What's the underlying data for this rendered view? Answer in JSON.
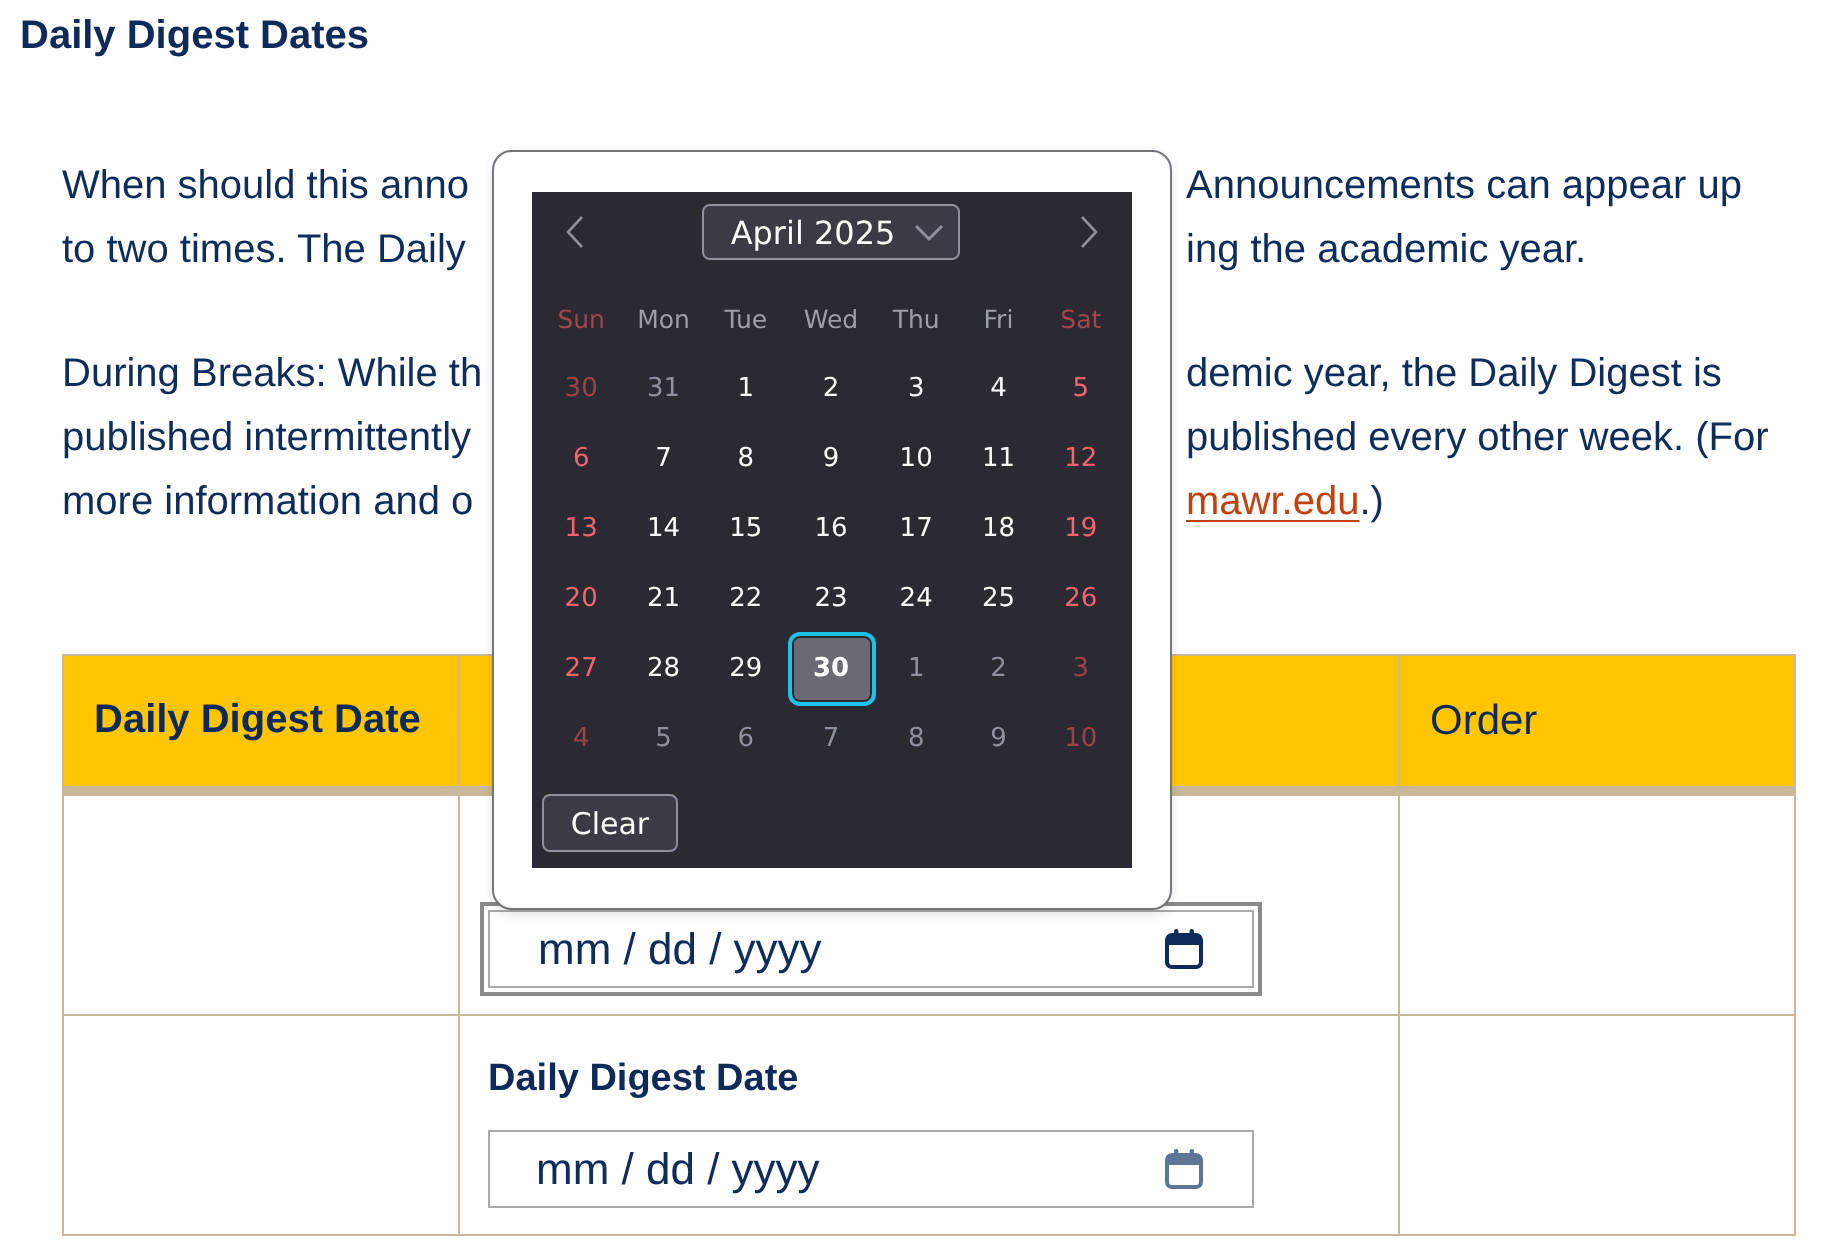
{
  "page": {
    "title": "Daily Digest Dates"
  },
  "intro": {
    "paragraphs": [
      {
        "lines": [
          {
            "before_popup": "When should this anno",
            "after_popup": [
              {
                "kind": "text",
                "text": "Announcements can appear up"
              }
            ]
          },
          {
            "before_popup": "to two times. The Daily",
            "after_popup": [
              {
                "kind": "text",
                "text": "ing the academic year."
              }
            ]
          }
        ]
      },
      {
        "lines": [
          {
            "before_popup": "During Breaks: While th",
            "after_popup": [
              {
                "kind": "text",
                "text": "demic year, the Daily Digest is"
              }
            ]
          },
          {
            "before_popup": "published intermittently",
            "after_popup": [
              {
                "kind": "text",
                "text": "published every other week. (For"
              }
            ]
          },
          {
            "before_popup": "more information and o",
            "after_popup": [
              {
                "kind": "link",
                "text": "mawr.edu"
              },
              {
                "kind": "text",
                "text": ".)"
              }
            ]
          }
        ]
      }
    ]
  },
  "table": {
    "columns": [
      {
        "label": "Daily Digest Date"
      },
      {},
      {
        "label": "Order"
      }
    ],
    "rows": [
      {
        "date_input": {
          "placeholder": "mm / dd / yyyy",
          "focused": true
        }
      },
      {
        "label": "Daily Digest Date",
        "date_input": {
          "placeholder": "mm / dd / yyyy",
          "focused": false
        }
      }
    ]
  },
  "date_picker": {
    "month_label": "April 2025",
    "weekdays": [
      {
        "label": "Sun",
        "weekend": true
      },
      {
        "label": "Mon",
        "weekend": false
      },
      {
        "label": "Tue",
        "weekend": false
      },
      {
        "label": "Wed",
        "weekend": false
      },
      {
        "label": "Thu",
        "weekend": false
      },
      {
        "label": "Fri",
        "weekend": false
      },
      {
        "label": "Sat",
        "weekend": true
      }
    ],
    "weeks": [
      [
        {
          "label": "30",
          "outside": true,
          "selected": false
        },
        {
          "label": "31",
          "outside": true,
          "selected": false
        },
        {
          "label": "1",
          "outside": false,
          "selected": false
        },
        {
          "label": "2",
          "outside": false,
          "selected": false
        },
        {
          "label": "3",
          "outside": false,
          "selected": false
        },
        {
          "label": "4",
          "outside": false,
          "selected": false
        },
        {
          "label": "5",
          "outside": false,
          "selected": false
        }
      ],
      [
        {
          "label": "6",
          "outside": false,
          "selected": false
        },
        {
          "label": "7",
          "outside": false,
          "selected": false
        },
        {
          "label": "8",
          "outside": false,
          "selected": false
        },
        {
          "label": "9",
          "outside": false,
          "selected": false
        },
        {
          "label": "10",
          "outside": false,
          "selected": false
        },
        {
          "label": "11",
          "outside": false,
          "selected": false
        },
        {
          "label": "12",
          "outside": false,
          "selected": false
        }
      ],
      [
        {
          "label": "13",
          "outside": false,
          "selected": false
        },
        {
          "label": "14",
          "outside": false,
          "selected": false
        },
        {
          "label": "15",
          "outside": false,
          "selected": false
        },
        {
          "label": "16",
          "outside": false,
          "selected": false
        },
        {
          "label": "17",
          "outside": false,
          "selected": false
        },
        {
          "label": "18",
          "outside": false,
          "selected": false
        },
        {
          "label": "19",
          "outside": false,
          "selected": false
        }
      ],
      [
        {
          "label": "20",
          "outside": false,
          "selected": false
        },
        {
          "label": "21",
          "outside": false,
          "selected": false
        },
        {
          "label": "22",
          "outside": false,
          "selected": false
        },
        {
          "label": "23",
          "outside": false,
          "selected": false
        },
        {
          "label": "24",
          "outside": false,
          "selected": false
        },
        {
          "label": "25",
          "outside": false,
          "selected": false
        },
        {
          "label": "26",
          "outside": false,
          "selected": false
        }
      ],
      [
        {
          "label": "27",
          "outside": false,
          "selected": false
        },
        {
          "label": "28",
          "outside": false,
          "selected": false
        },
        {
          "label": "29",
          "outside": false,
          "selected": false
        },
        {
          "label": "30",
          "outside": false,
          "selected": true
        },
        {
          "label": "1",
          "outside": true,
          "selected": false
        },
        {
          "label": "2",
          "outside": true,
          "selected": false
        },
        {
          "label": "3",
          "outside": true,
          "selected": false
        }
      ],
      [
        {
          "label": "4",
          "outside": true,
          "selected": false
        },
        {
          "label": "5",
          "outside": true,
          "selected": false
        },
        {
          "label": "6",
          "outside": true,
          "selected": false
        },
        {
          "label": "7",
          "outside": true,
          "selected": false
        },
        {
          "label": "8",
          "outside": true,
          "selected": false
        },
        {
          "label": "9",
          "outside": true,
          "selected": false
        },
        {
          "label": "10",
          "outside": true,
          "selected": false
        }
      ]
    ],
    "clear_button": "Clear"
  }
}
